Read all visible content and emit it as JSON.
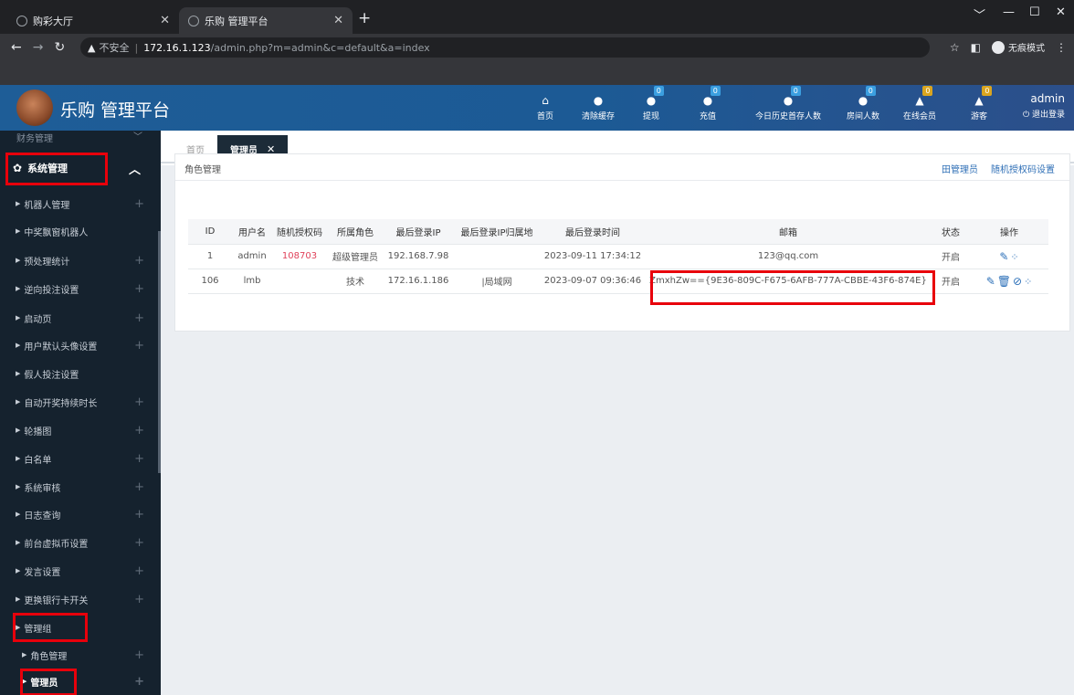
{
  "browser": {
    "tabs": [
      {
        "title": "购彩大厅",
        "active": false
      },
      {
        "title": "乐购 管理平台",
        "active": true
      }
    ],
    "new_tab": "+",
    "url_warning": "不安全",
    "url_host": "172.16.1.123",
    "url_path": "/admin.php?m=admin&c=default&a=index",
    "incognito_label": "无痕模式",
    "window_controls": [
      "﹀",
      "—",
      "☐",
      "✕"
    ]
  },
  "header": {
    "brand": "乐购 管理平台",
    "nav": [
      {
        "label": "首页",
        "icon": "home-icon",
        "badge": ""
      },
      {
        "label": "清除缓存",
        "icon": "clear-cache-icon",
        "badge": ""
      },
      {
        "label": "提现",
        "icon": "withdraw-icon",
        "badge": "0"
      },
      {
        "label": "充值",
        "icon": "recharge-icon",
        "badge": "0"
      },
      {
        "label": "今日历史首存人数",
        "icon": "first-deposit-icon",
        "badge": "0"
      },
      {
        "label": "房间人数",
        "icon": "room-icon",
        "badge": "0"
      },
      {
        "label": "在线会员",
        "icon": "user-icon",
        "badge": "0"
      },
      {
        "label": "游客",
        "icon": "guest-icon",
        "badge": "0"
      }
    ],
    "user": "admin",
    "logout": "退出登录"
  },
  "sidebar": {
    "top_partial": "财务管理",
    "section": "系统管理",
    "items": [
      {
        "label": "机器人管理",
        "plus": true
      },
      {
        "label": "中奖飘窗机器人",
        "plus": false
      },
      {
        "label": "预处理统计",
        "plus": true
      },
      {
        "label": "逆向投注设置",
        "plus": true
      },
      {
        "label": "启动页",
        "plus": true
      },
      {
        "label": "用户默认头像设置",
        "plus": true
      },
      {
        "label": "假人投注设置",
        "plus": false
      },
      {
        "label": "自动开奖持续时长",
        "plus": true
      },
      {
        "label": "轮播图",
        "plus": true
      },
      {
        "label": "白名单",
        "plus": true
      },
      {
        "label": "系统审核",
        "plus": true
      },
      {
        "label": "日志查询",
        "plus": true
      },
      {
        "label": "前台虚拟币设置",
        "plus": true
      },
      {
        "label": "发言设置",
        "plus": true
      },
      {
        "label": "更换银行卡开关",
        "plus": true
      },
      {
        "label": "管理组",
        "plus": false
      },
      {
        "label": "角色管理",
        "plus": true
      },
      {
        "label": "管理员",
        "plus": true
      }
    ]
  },
  "content_tabs": {
    "home": "首页",
    "current": "管理员"
  },
  "panel": {
    "title": "角色管理",
    "link_add": "田管理员",
    "link_auth": "随机授权码设置"
  },
  "table": {
    "headers": [
      "ID",
      "用户名",
      "随机授权码",
      "所属角色",
      "最后登录IP",
      "最后登录IP归属地",
      "最后登录时间",
      "邮箱",
      "状态",
      "操作"
    ],
    "rows": [
      {
        "id": "1",
        "username": "admin",
        "auth": "108703",
        "role": "超级管理员",
        "ip": "192.168.7.98",
        "ip_loc": "",
        "time": "2023-09-11 17:34:12",
        "email": "123@qq.com",
        "status": "开启"
      },
      {
        "id": "106",
        "username": "lmb",
        "auth": "",
        "role": "技术",
        "ip": "172.16.1.186",
        "ip_loc": "|局域网",
        "time": "2023-09-07 09:36:46",
        "email": "ZmxhZw=={9E36-809C-F675-6AFB-777A-CBBE-43F6-874E}",
        "status": "开启"
      }
    ]
  },
  "colors": {
    "header_bg": "#1e5d97",
    "sidebar_bg": "#15222e",
    "highlight_red": "#e8000b",
    "link_blue": "#2f6fb6"
  }
}
